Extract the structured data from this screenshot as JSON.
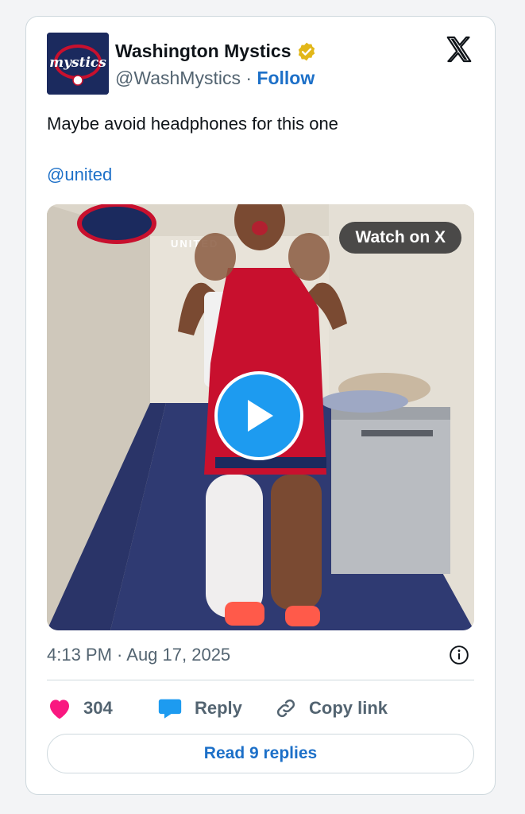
{
  "author": {
    "name": "Washington Mystics",
    "handle": "@WashMystics",
    "separator": "·",
    "follow_label": "Follow",
    "avatar_icon": "mystics-logo",
    "avatar_logo_text": "mystics",
    "verified_icon": "verified-badge-icon"
  },
  "tweet": {
    "text": "Maybe avoid headphones for this one",
    "mention": "@united",
    "timestamp": "4:13 PM · Aug 17, 2025"
  },
  "media": {
    "watch_label": "Watch on X",
    "type": "video",
    "play_icon": "play-icon"
  },
  "actions": {
    "likes": "304",
    "reply_label": "Reply",
    "copy_link_label": "Copy link",
    "read_replies_label": "Read 9 replies"
  },
  "colors": {
    "link": "#1d70c8",
    "like": "#f91880",
    "verified_gold": "#e2b719",
    "play": "#1d9bf0"
  }
}
